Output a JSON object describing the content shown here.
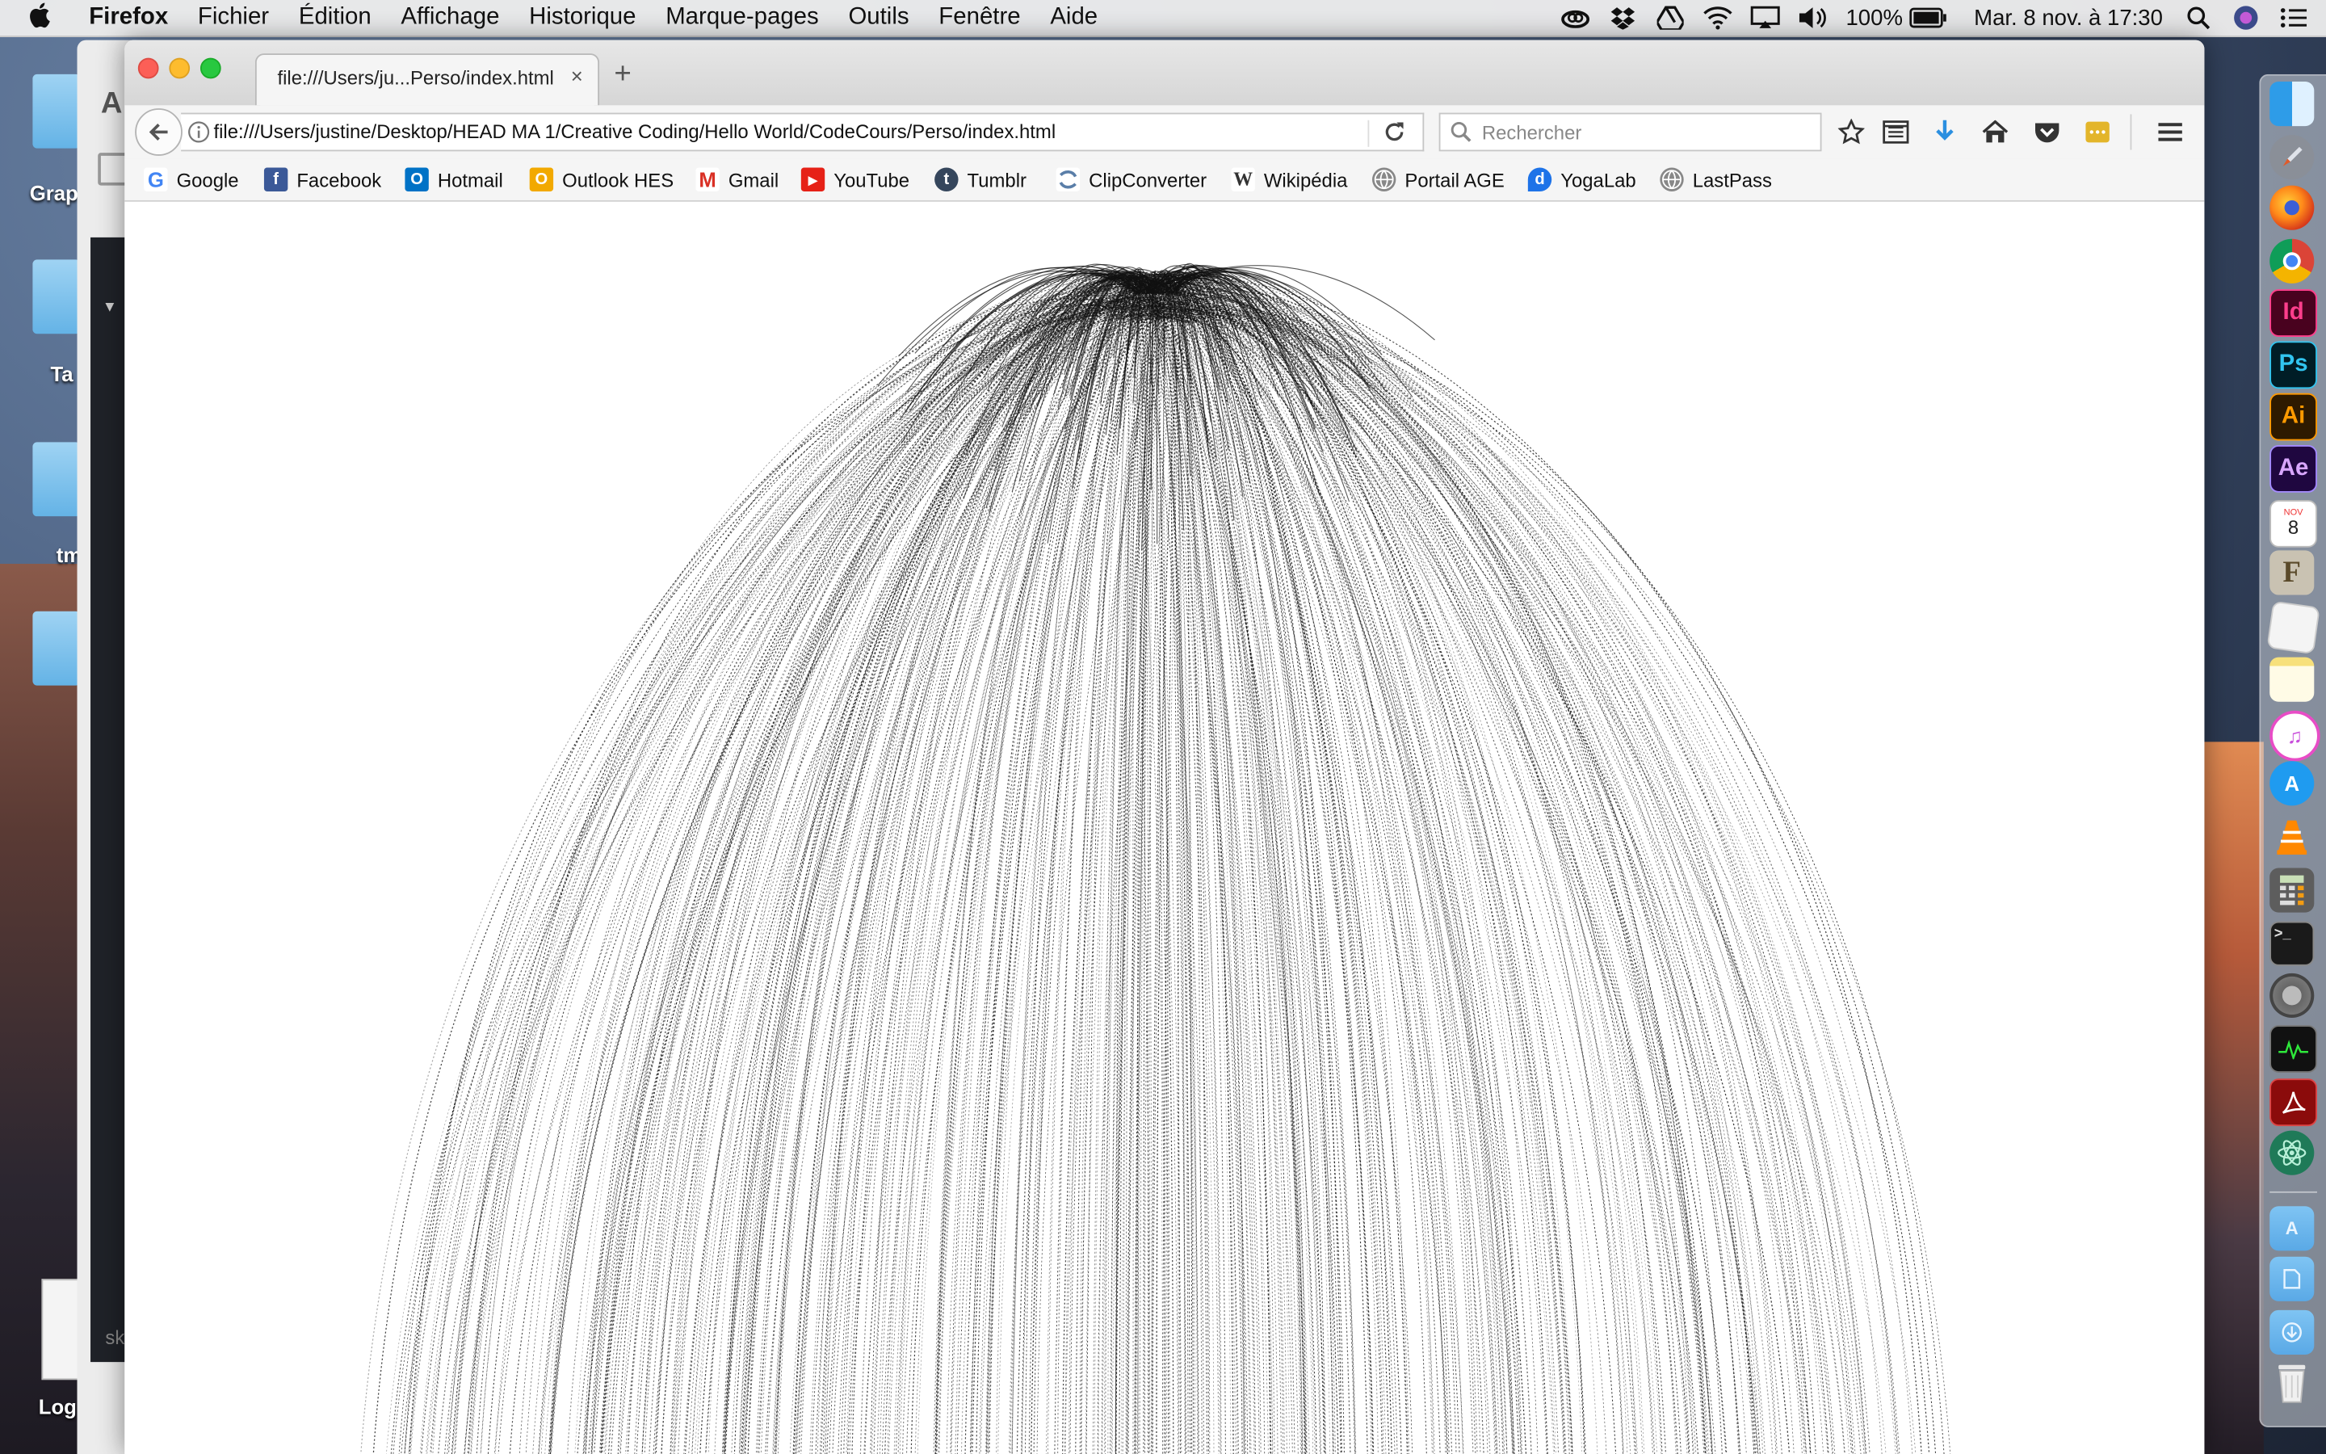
{
  "menubar": {
    "app_name": "Firefox",
    "items": [
      "Fichier",
      "Édition",
      "Affichage",
      "Historique",
      "Marque-pages",
      "Outils",
      "Fenêtre",
      "Aide"
    ],
    "battery": "100%",
    "clock": "Mar. 8 nov. à 17:30"
  },
  "desktop": {
    "labels": [
      "Grap",
      "Ta",
      "tm",
      "Log"
    ],
    "bg_window_label": "A",
    "bg_window_label2": "sk"
  },
  "browser": {
    "tab_title": "file:///Users/ju...Perso/index.html",
    "tab_close": "×",
    "new_tab": "+",
    "url": "file:///Users/justine/Desktop/HEAD MA 1/Creative Coding/Hello World/CodeCours/Perso/index.html",
    "search_placeholder": "Rechercher",
    "bookmarks": [
      {
        "label": "Google",
        "icon": "google-icon",
        "color": "#4285f4"
      },
      {
        "label": "Facebook",
        "icon": "facebook-icon",
        "color": "#3b5998"
      },
      {
        "label": "Hotmail",
        "icon": "outlook-icon",
        "color": "#0072c6"
      },
      {
        "label": "Outlook HES",
        "icon": "outlook-hes-icon",
        "color": "#f2a900"
      },
      {
        "label": "Gmail",
        "icon": "gmail-icon",
        "color": "#d93025"
      },
      {
        "label": "YouTube",
        "icon": "youtube-icon",
        "color": "#e62117"
      },
      {
        "label": "Tumblr",
        "icon": "tumblr-icon",
        "color": "#35465c"
      },
      {
        "label": "ClipConverter",
        "icon": "clipconverter-icon",
        "color": "#5a7ea8"
      },
      {
        "label": "Wikipédia",
        "icon": "wikipedia-icon",
        "color": "#333333"
      },
      {
        "label": "Portail AGE",
        "icon": "globe-icon",
        "color": "#777777"
      },
      {
        "label": "YogaLab",
        "icon": "yogalab-icon",
        "color": "#1e73e8"
      },
      {
        "label": "LastPass",
        "icon": "globe-icon",
        "color": "#777777"
      }
    ]
  },
  "canvas": {
    "description_strands": 600,
    "stroke_color": "#111111"
  },
  "dock": {
    "apps": [
      "finder-icon",
      "launchpad-icon",
      "firefox-icon",
      "chrome-icon",
      "indesign-icon",
      "photoshop-icon",
      "illustrator-icon",
      "aftereffects-icon",
      "calendar-icon",
      "fontbook-icon",
      "textedit-icon",
      "notes-icon",
      "itunes-icon",
      "appstore-icon",
      "vlc-icon",
      "calculator-icon",
      "terminal-icon",
      "systemprefs-icon",
      "activitymonitor-icon",
      "acrobat-icon",
      "atom-icon",
      "applications-folder-icon",
      "documents-folder-icon",
      "downloads-folder-icon",
      "trash-icon"
    ],
    "labels": {
      "id": "Id",
      "ps": "Ps",
      "ai": "Ai",
      "ae": "Ae",
      "cal_month": "NOV",
      "cal_day": "8",
      "font": "F"
    }
  }
}
